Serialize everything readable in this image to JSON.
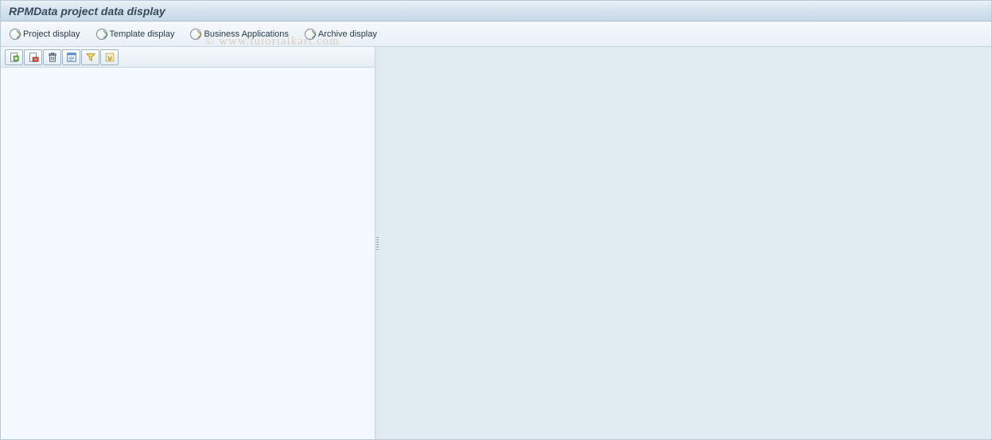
{
  "title": "RPMData project data display",
  "app_toolbar": {
    "buttons": [
      {
        "label": "Project display",
        "icon_style": "green"
      },
      {
        "label": "Template display",
        "icon_style": "green"
      },
      {
        "label": "Business Applications",
        "icon_style": "orange"
      },
      {
        "label": "Archive display",
        "icon_style": "green"
      }
    ]
  },
  "icon_toolbar": {
    "buttons": [
      {
        "name": "create",
        "title": "Create"
      },
      {
        "name": "open",
        "title": "Open"
      },
      {
        "name": "delete",
        "title": "Delete"
      },
      {
        "name": "details-toggle",
        "title": "Details"
      },
      {
        "name": "filter",
        "title": "Filter"
      },
      {
        "name": "expand",
        "title": "Expand"
      }
    ]
  },
  "watermark": "© www.tutorialkart.com"
}
